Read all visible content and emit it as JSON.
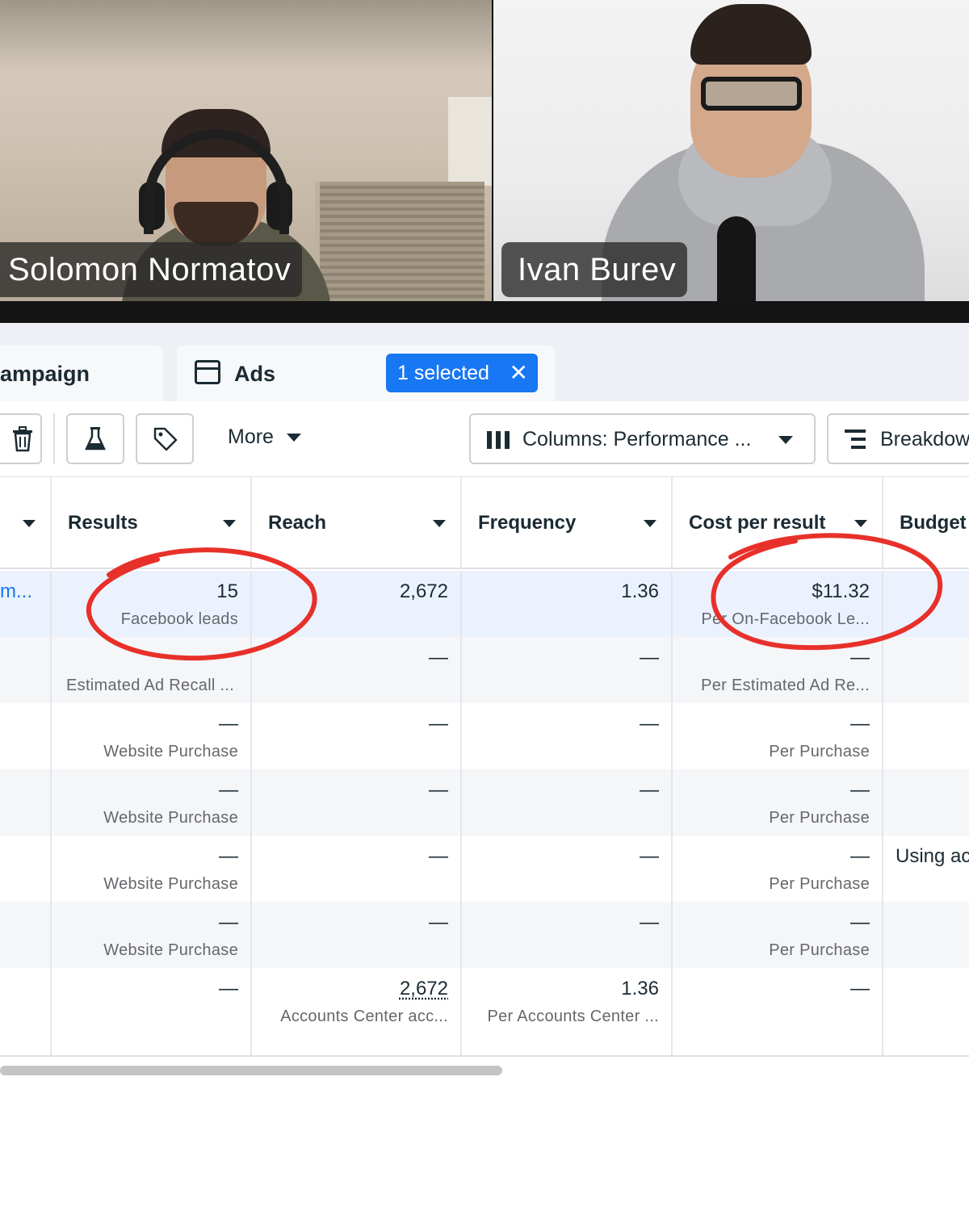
{
  "video_call": {
    "participants": [
      {
        "name": "Solomon Normatov"
      },
      {
        "name": "Ivan Burev"
      }
    ]
  },
  "tabs": {
    "campaign_label": "ampaign",
    "ads_label": "Ads",
    "selected_chip": "1 selected",
    "chip_close": "✕"
  },
  "toolbar": {
    "trash_icon": "trash-icon",
    "beaker_icon": "beaker-icon",
    "tag_icon": "tag-icon",
    "more_label": "More",
    "columns_label": "Columns: Performance ...",
    "breakdown_label": "Breakdow"
  },
  "table": {
    "columns": [
      "Results",
      "Reach",
      "Frequency",
      "Cost per result",
      "Budget"
    ],
    "rows": [
      {
        "name": "m...",
        "results": "15",
        "results_sub": "Facebook leads",
        "reach": "2,672",
        "frequency": "1.36",
        "cost": "$11.32",
        "cost_sub": "Per On-Facebook Le...",
        "budget": ""
      },
      {
        "name": "",
        "results": "",
        "results_sub": "Estimated Ad Recall ...",
        "reach": "—",
        "frequency": "—",
        "cost": "—",
        "cost_sub": "Per Estimated Ad Re...",
        "budget": ""
      },
      {
        "name": "",
        "results": "—",
        "results_sub": "Website Purchase",
        "reach": "—",
        "frequency": "—",
        "cost": "—",
        "cost_sub": "Per Purchase",
        "budget": ""
      },
      {
        "name": "",
        "results": "—",
        "results_sub": "Website Purchase",
        "reach": "—",
        "frequency": "—",
        "cost": "—",
        "cost_sub": "Per Purchase",
        "budget": ""
      },
      {
        "name": "",
        "results": "—",
        "results_sub": "Website Purchase",
        "reach": "—",
        "frequency": "—",
        "cost": "—",
        "cost_sub": "Per Purchase",
        "budget": "Using ac"
      },
      {
        "name": "",
        "results": "—",
        "results_sub": "Website Purchase",
        "reach": "—",
        "frequency": "—",
        "cost": "—",
        "cost_sub": "Per Purchase",
        "budget": ""
      }
    ],
    "total": {
      "results": "—",
      "reach": "2,672",
      "reach_sub": "Accounts Center acc...",
      "frequency": "1.36",
      "frequency_sub": "Per Accounts Center ...",
      "cost": "—"
    }
  },
  "colors": {
    "accent": "#1877f2",
    "highlight_row": "#ebf2fd",
    "annotation": "#e8302a"
  }
}
